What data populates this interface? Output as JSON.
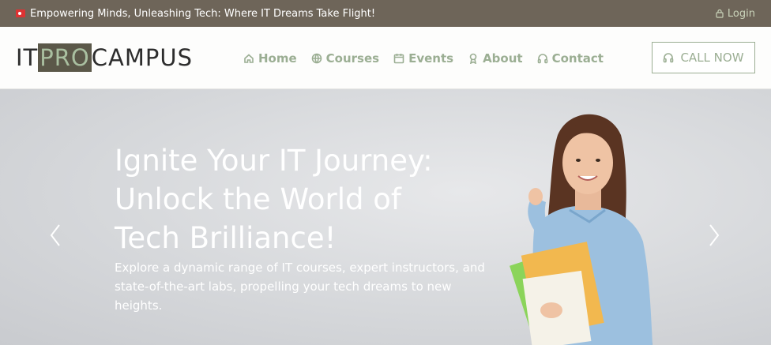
{
  "topbar": {
    "tagline": "Empowering Minds, Unleashing Tech: Where IT Dreams Take Flight!",
    "login_label": "Login"
  },
  "logo": {
    "part1": "IT",
    "part2": "PRO",
    "part3": "CAMPUS"
  },
  "nav": [
    {
      "label": "Home",
      "icon": "home-icon"
    },
    {
      "label": "Courses",
      "icon": "globe-icon"
    },
    {
      "label": "Events",
      "icon": "calendar-icon"
    },
    {
      "label": "About",
      "icon": "award-icon"
    },
    {
      "label": "Contact",
      "icon": "headphones-icon"
    }
  ],
  "call_button": {
    "label": "CALL NOW",
    "icon": "headphones-icon"
  },
  "hero": {
    "title_lines": [
      "Ignite Your IT Journey:",
      "Unlock the World of",
      "Tech Brilliance!"
    ],
    "description": "Explore a dynamic range of IT courses, expert instructors, and state-of-the-art labs, propelling your tech dreams to new heights."
  },
  "colors": {
    "topbar_bg": "#6e6559",
    "accent_green": "#9bae93",
    "logo_highlight_bg": "#5b5849"
  }
}
